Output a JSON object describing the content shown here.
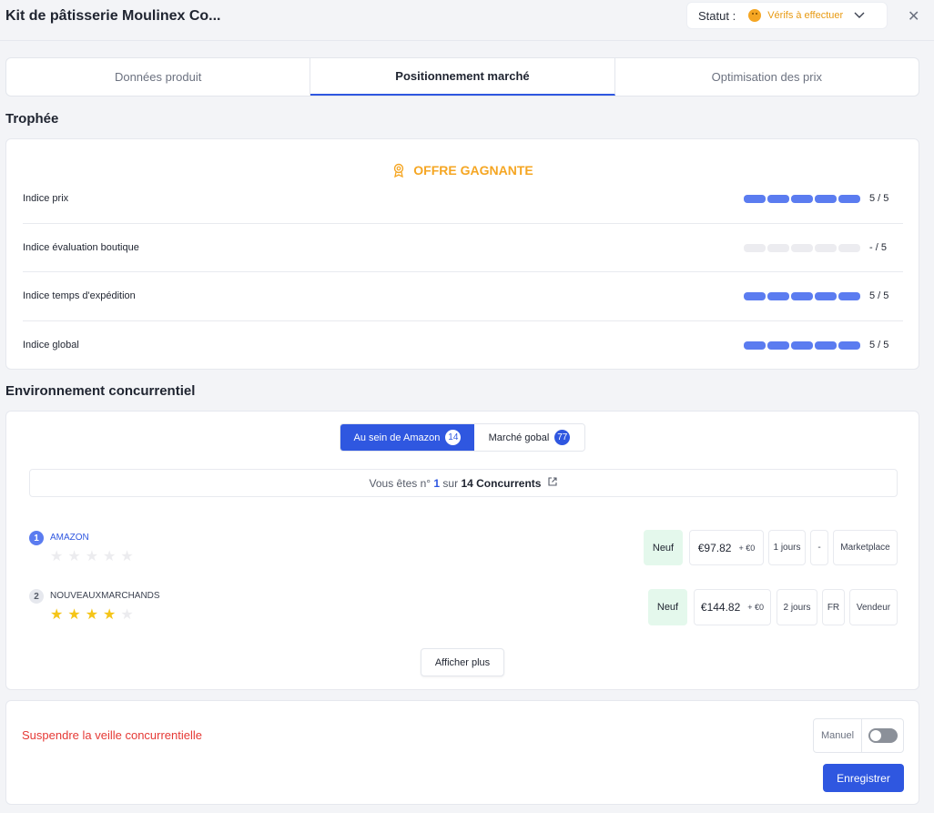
{
  "header": {
    "title": "Kit de pâtisserie Moulinex Co...",
    "status_label": "Statut :",
    "status_value": "Vérifs à effectuer",
    "close_glyph": "✕"
  },
  "tabs": [
    {
      "label": "Données produit",
      "active": false
    },
    {
      "label": "Positionnement marché",
      "active": true
    },
    {
      "label": "Optimisation des prix",
      "active": false
    }
  ],
  "trophy": {
    "section_title": "Trophée",
    "winner_label": "OFFRE GAGNANTE",
    "indices": [
      {
        "name": "Indice prix",
        "filled": 5,
        "score": "5 / 5"
      },
      {
        "name": "Indice évaluation boutique",
        "filled": 0,
        "score": "- / 5"
      },
      {
        "name": "Indice temps d'expédition",
        "filled": 5,
        "score": "5 / 5"
      },
      {
        "name": "Indice global",
        "filled": 5,
        "score": "5 / 5"
      }
    ]
  },
  "environment": {
    "section_title": "Environnement concurrentiel",
    "toggle": {
      "amazon_label": "Au sein de Amazon",
      "amazon_count": "14",
      "global_label": "Marché gobal",
      "global_count": "77"
    },
    "rank_info": {
      "prefix": "Vous êtes n°",
      "rank": "1",
      "middle": "sur",
      "total": "14 Concurrents"
    },
    "competitors": [
      {
        "rank": "1",
        "name": "AMAZON",
        "stars": 0,
        "condition": "Neuf",
        "price": "€97.82",
        "shipping": "+ €0",
        "delay": "1 jours",
        "country": "-",
        "type": "Marketplace"
      },
      {
        "rank": "2",
        "name": "NOUVEAUXMARCHANDS",
        "stars": 4,
        "condition": "Neuf",
        "price": "€144.82",
        "shipping": "+ €0",
        "delay": "2 jours",
        "country": "FR",
        "type": "Vendeur"
      }
    ],
    "more_label": "Afficher plus"
  },
  "footer": {
    "suspend_label": "Suspendre la veille concurrentielle",
    "manual_label": "Manuel",
    "manual_on": false,
    "save_label": "Enregistrer"
  },
  "colors": {
    "accent": "#2f57e0",
    "bar_on": "#5b7cf0",
    "winner": "#f5a623",
    "danger": "#e53935",
    "neuf_bg": "#e4f8ec"
  }
}
